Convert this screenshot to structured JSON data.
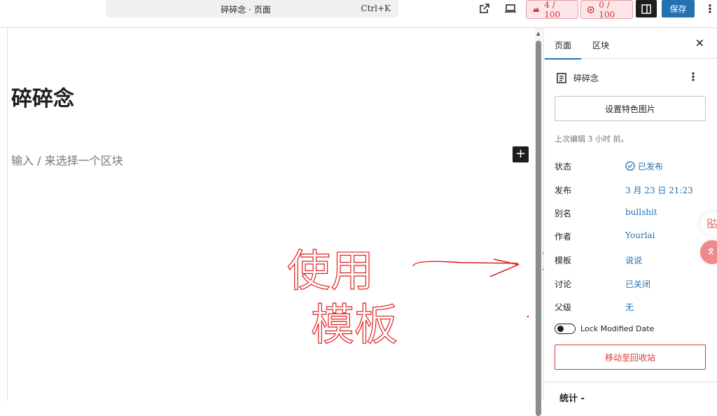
{
  "topbar": {
    "command_label": "碎碎念 · 页面",
    "command_shortcut": "Ctrl+K",
    "ai_counter_1": "4 / 100",
    "ai_counter_2": "0 / 100",
    "save_label": "保存"
  },
  "editor": {
    "post_title": "碎碎念",
    "block_placeholder": "输入 / 来选择一个区块",
    "annotation_text_1": "使用",
    "annotation_text_2": "模板"
  },
  "sidebar": {
    "tab_page": "页面",
    "tab_block": "区块",
    "page_name": "碎碎念",
    "featured_image_button": "设置特色图片",
    "last_edited": "上次编辑 3 小时 前。",
    "rows": [
      {
        "label": "状态",
        "value": "已发布"
      },
      {
        "label": "发布",
        "value": "3 月 23 日 21:23"
      },
      {
        "label": "别名",
        "value": "bullshit"
      },
      {
        "label": "作者",
        "value": "Yourlai"
      },
      {
        "label": "模板",
        "value": "说说"
      },
      {
        "label": "讨论",
        "value": "已关闭"
      },
      {
        "label": "父级",
        "value": "无"
      }
    ],
    "lock_modified_label": "Lock Modified Date",
    "trash_button": "移动至回收站",
    "stats_label": "统计 -"
  },
  "colors": {
    "accent": "#2271b1",
    "danger": "#d63638",
    "annotation": "#e02020"
  }
}
